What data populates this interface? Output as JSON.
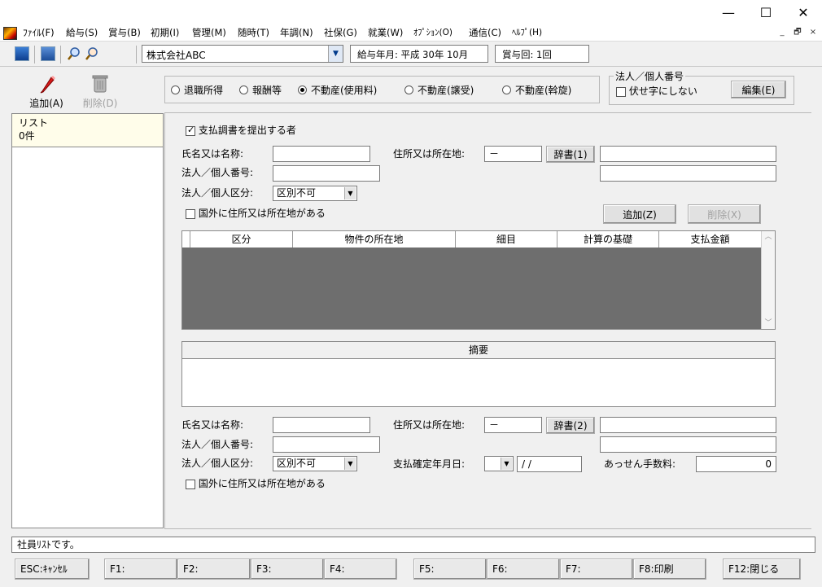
{
  "window": {
    "minimize": "—",
    "maximize": "☐",
    "close": "✕"
  },
  "menu": [
    "ﾌｧｲﾙ(F)",
    "給与(S)",
    "賞与(B)",
    "初期(I)",
    "管理(M)",
    "随時(T)",
    "年調(N)",
    "社保(G)",
    "就業(W)",
    "ｵﾌﾟｼｮﾝ(O)",
    "通信(C)",
    "ﾍﾙﾌﾟ(H)"
  ],
  "mdi": {
    "minimize": "_",
    "restore": "🗗",
    "close": "×"
  },
  "toolbar": {
    "company": "株式会社ABC",
    "pay_month": "給与年月: 平成 30年 10月",
    "bonus_count": "賞与回: 1回"
  },
  "left": {
    "add_label": "追加(A)",
    "delete_label": "削除(D)",
    "list_title": "リスト",
    "list_count": "0件"
  },
  "radios": [
    {
      "label": "退職所得",
      "selected": false
    },
    {
      "label": "報酬等",
      "selected": false
    },
    {
      "label": "不動産(使用料)",
      "selected": true
    },
    {
      "label": "不動産(譲受)",
      "selected": false
    },
    {
      "label": "不動産(斡旋)",
      "selected": false
    }
  ],
  "corp_number": {
    "title": "法人／個人番号",
    "no_mask_label": "伏せ字にしない",
    "edit_label": "編集(E)"
  },
  "form": {
    "submit_label": "支払調書を提出する者",
    "name_label": "氏名又は名称:",
    "address_label": "住所又は所在地:",
    "postal_value": "－",
    "dict1_label": "辞書(1)",
    "number_label": "法人／個人番号:",
    "kubun_label": "法人／個人区分:",
    "kubun_value": "区別不可",
    "abroad_label": "国外に住所又は所在地がある",
    "add_label": "追加(Z)",
    "delete_label": "削除(X)"
  },
  "grid": {
    "columns": [
      "区分",
      "物件の所在地",
      "細目",
      "計算の基礎",
      "支払金額"
    ]
  },
  "memo": {
    "title": "摘要"
  },
  "form2": {
    "name_label": "氏名又は名称:",
    "address_label": "住所又は所在地:",
    "postal_value": "－",
    "dict2_label": "辞書(2)",
    "number_label": "法人／個人番号:",
    "kubun_label": "法人／個人区分:",
    "kubun_value": "区別不可",
    "paydate_label": "支払確定年月日:",
    "paydate_value": "/ /",
    "fee_label": "あっせん手数料:",
    "fee_value": "0",
    "abroad_label": "国外に住所又は所在地がある"
  },
  "status_text": "社員ﾘｽﾄです。",
  "fkeys": [
    "ESC:ｷｬﾝｾﾙ",
    "F1:",
    "F2:",
    "F3:",
    "F4:",
    "F5:",
    "F6:",
    "F7:",
    "F8:印刷",
    "F12:閉じる"
  ],
  "colors": {
    "grid_body": "#6e6e6e",
    "list_header": "#fffdea",
    "title_bar": "#ffffff"
  }
}
